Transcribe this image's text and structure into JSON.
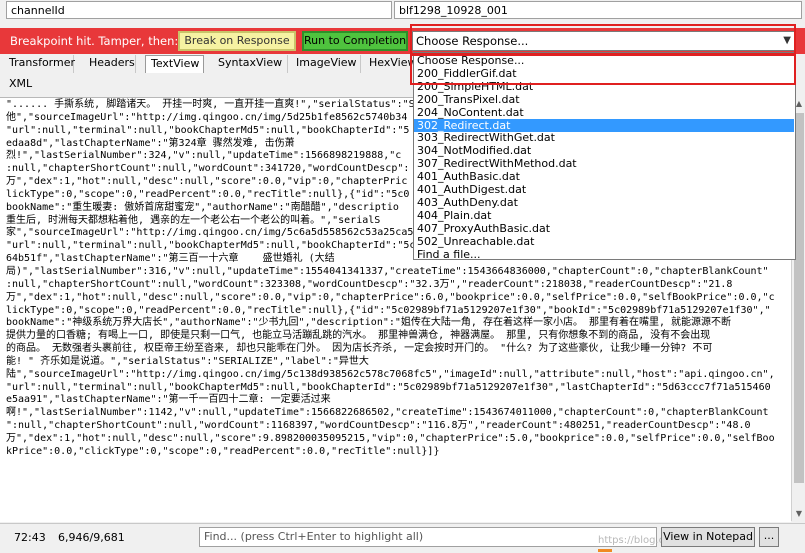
{
  "field_row": {
    "name": "channelId",
    "value": "blf1298_10928_001"
  },
  "breakpoint": {
    "text": "Breakpoint hit. Tamper, then:",
    "break_button": "Break on Response",
    "run_button": "Run to Completion",
    "select_value": "Choose Response..."
  },
  "tabs": {
    "row1": [
      "Transformer",
      "Headers",
      "TextView",
      "SyntaxView",
      "ImageView",
      "HexView"
    ],
    "row2": [
      "XML"
    ],
    "selected": "TextView"
  },
  "dropdown": {
    "items": [
      "Choose Response...",
      "200_FiddlerGif.dat",
      "200_SimpleHTML.dat",
      "200_TransPixel.dat",
      "204_NoContent.dat",
      "302_Redirect.dat",
      "303_RedirectWithGet.dat",
      "304_NotModified.dat",
      "307_RedirectWithMethod.dat",
      "401_AuthBasic.dat",
      "401_AuthDigest.dat",
      "403_AuthDeny.dat",
      "404_Plain.dat",
      "407_ProxyAuthBasic.dat",
      "502_Unreachable.dat",
      "Find a file..."
    ],
    "selected": "302_Redirect.dat"
  },
  "body_lines": [
    "\"...... 手撕系统, 脚踏诸天。 开挂一时爽, 一直开挂一直爽!\",\"serialStatus\":\"SERIALIZE\",\"label\":\"现代都市\"",
    "他\",\"sourceImageUrl\":\"http://img.qingoo.cn/img/5d25b1fe8562c5740b34",
    "\"url\":null,\"terminal\":null,\"bookChapterMd5\":null,\"bookChapterId\":\"5",
    "edaa8d\",\"lastChapterName\":\"第324章 骤然发难, 击伤萧",
    "烈!\",\"lastSerialNumber\":324,\"v\":null,\"updateTime\":1566898219888,\"c",
    ":null,\"chapterShortCount\":null,\"wordCount\":341720,\"wordCountDescp\":",
    "万\",\"dex\":1,\"hot\":null,\"desc\":null,\"score\":0.0,\"vip\":0,\"chapterPric",
    "lickType\":0,\"scope\":0,\"readPercent\":0.0,\"recTitle\":null},{\"id\":\"5c0",
    "bookName\":\"重生暖妻: 傲娇首席甜蜜宠\",\"authorName\":\"南醋醋\",\"descriptio",
    "重生后, 时洲每天都想粘着他, 遇亲的左一个老公右一个老公的叫着。\",\"serialS",
    "家\",\"sourceImageUrl\":\"http://img.qingoo.cn/img/5c6a5d558562c53a25ca5d53b2b3ec7a\",\"imageId\":null,\"attribute\":null,\"host\":\"api.qingoo.cn\",",
    "\"url\":null,\"terminal\":null,\"bookChapterMd5\":null,\"bookChapterId\":\"5c0274c433a08c65b6d140cd\",\"lastChapterId\":\"5ca0c8e8f71a51792b",
    "64b51f\",\"lastChapterName\":\"第三百一十六章    盛世婚礼 (大结",
    "局)\",\"lastSerialNumber\":316,\"v\":null,\"updateTime\":1554041341337,\"createTime\":1543664836000,\"chapterCount\":0,\"chapterBlankCount\"",
    ":null,\"chapterShortCount\":null,\"wordCount\":323308,\"wordCountDescp\":\"32.3万\",\"readerCount\":218038,\"readerCountDescp\":\"21.8",
    "万\",\"dex\":1,\"hot\":null,\"desc\":null,\"score\":0.0,\"vip\":0,\"chapterPrice\":6.0,\"bookprice\":0.0,\"selfPrice\":0.0,\"selfBookPrice\":0.0,\"c",
    "lickType\":0,\"scope\":0,\"readPercent\":0.0,\"recTitle\":null},{\"id\":\"5c02989bf71a5129207e1f30\",\"bookId\":\"5c02989bf71a5129207e1f30\",\"",
    "bookName\":\"神级系统万界大店长\",\"authorName\":\"少书九回\",\"description\":\"姐传在大陆一角, 存在着这样一家小店。 那里有着在嘴里, 就能源源不断",
    "提供力量的口香糖; 有喝上一口, 即使是只剩一口气, 也能立马活蹦乱跳的汽水。 那里神兽满仓, 神器满屋。 那里, 只有你想象不到的商品, 没有不会出现",
    "的商品。 无数强者头裹前往, 权臣帝王纷至沓来, 却也只能乖在门外。 因为店长齐杀, 一定会按时开门的。 \"什么? 为了这些豪伙, 让我少睡一分钟? 不可",
    "能! \" 齐乐如是说道。\",\"serialStatus\":\"SERIALIZE\",\"label\":\"异世大",
    "陆\",\"sourceImageUrl\":\"http://img.qingoo.cn/img/5c138d938562c578c7068fc5\",\"imageId\":null,\"attribute\":null,\"host\":\"api.qingoo.cn\",",
    "\"url\":null,\"terminal\":null,\"bookChapterMd5\":null,\"bookChapterId\":\"5c02989bf71a5129207e1f30\",\"lastChapterId\":\"5d63ccc7f71a515460",
    "e5aa91\",\"lastChapterName\":\"第一千一百四十二章: 一定要活过来",
    "啊!\",\"lastSerialNumber\":1142,\"v\":null,\"updateTime\":1566822686502,\"createTime\":1543674011000,\"chapterCount\":0,\"chapterBlankCount",
    "\":null,\"chapterShortCount\":null,\"wordCount\":1168397,\"wordCountDescp\":\"116.8万\",\"readerCount\":480251,\"readerCountDescp\":\"48.0",
    "万\",\"dex\":1,\"hot\":null,\"desc\":null,\"score\":9.898200035095215,\"vip\":0,\"chapterPrice\":5.0,\"bookprice\":0.0,\"selfPrice\":0.0,\"selfBoo",
    "kPrice\":0.0,\"clickType\":0,\"scope\":0,\"readPercent\":0.0,\"recTitle\":null}]}"
  ],
  "status": {
    "position": "72:43",
    "counter": "6,946/9,681",
    "find_placeholder": "Find... (press Ctrl+Enter to highlight all)",
    "notepad_button": "View in Notepad",
    "ellipsis": "...",
    "watermark": "https://blog.csdn.net/u010..."
  }
}
